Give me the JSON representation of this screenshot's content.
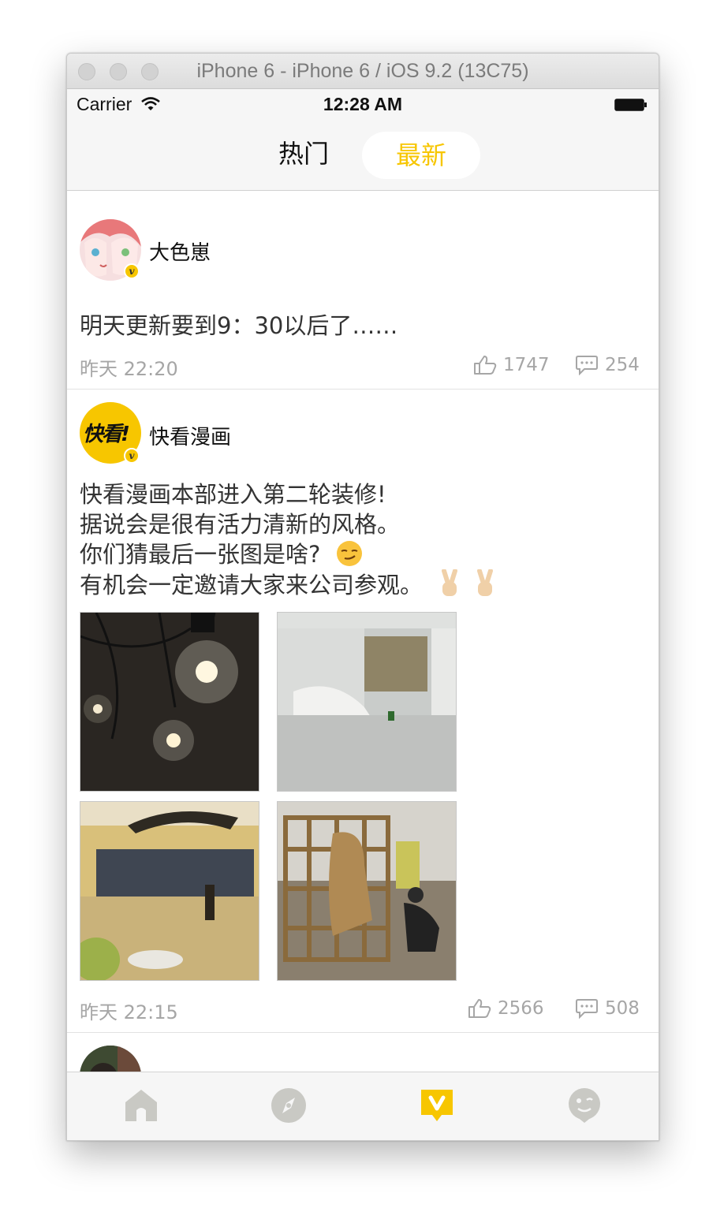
{
  "window": {
    "title": "iPhone 6 - iPhone 6 / iOS 9.2 (13C75)"
  },
  "status_bar": {
    "carrier": "Carrier",
    "time": "12:28 AM"
  },
  "nav": {
    "tabs": [
      {
        "label": "热门",
        "active": false
      },
      {
        "label": "最新",
        "active": true
      }
    ]
  },
  "colors": {
    "accent": "#f7c600",
    "muted": "#a6a6a6",
    "icon_gray": "#c9c9c4"
  },
  "feed": {
    "posts": [
      {
        "username": "大色崽",
        "verified": true,
        "content": "明天更新要到9：30以后了……",
        "time": "昨天 22:20",
        "likes": "1747",
        "comments": "254"
      },
      {
        "username": "快看漫画",
        "verified": true,
        "avatar_text": "快看!",
        "content_lines": [
          "快看漫画本部进入第二轮装修!",
          "据说会是很有活力清新的风格。",
          "你们猜最后一张图是啥?",
          "有机会一定邀请大家来公司参观。"
        ],
        "emoji": [
          "smirk-emoji",
          "victory-hand-emoji",
          "victory-hand-emoji"
        ],
        "photos": [
          "light-bulbs-photo",
          "covered-room-photo",
          "yellow-office-photo",
          "wooden-sculpture-photo"
        ],
        "time": "昨天 22:15",
        "likes": "2566",
        "comments": "508"
      }
    ]
  },
  "tab_bar": {
    "items": [
      "home-icon",
      "discover-icon",
      "v-feed-icon",
      "me-icon"
    ],
    "active": "v-feed-icon"
  }
}
